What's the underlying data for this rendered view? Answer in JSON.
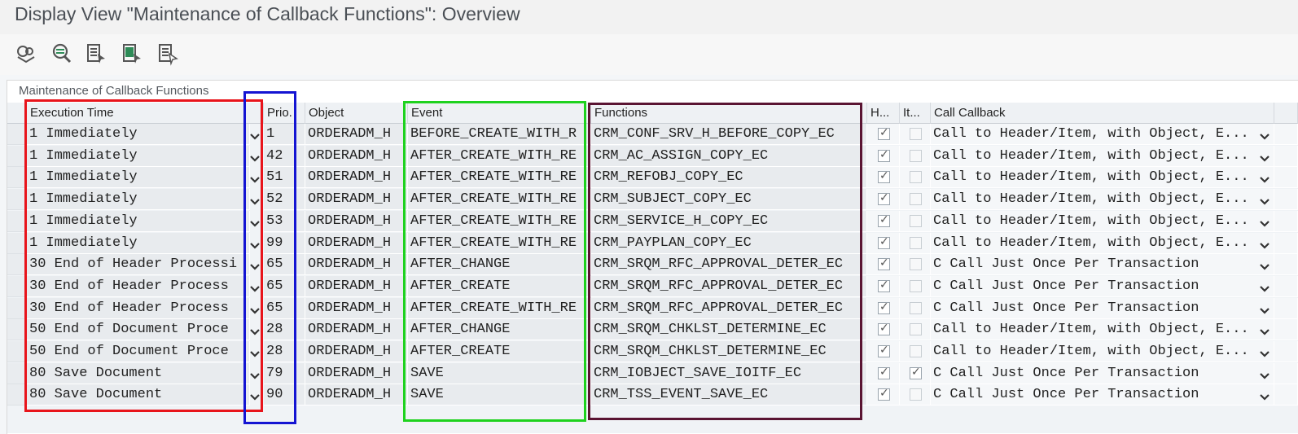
{
  "window": {
    "title": "Display View \"Maintenance of Callback Functions\": Overview"
  },
  "toolbar": {
    "buttons": [
      {
        "name": "display-change-icon"
      },
      {
        "name": "details-icon"
      },
      {
        "name": "select-all-icon"
      },
      {
        "name": "select-block-icon"
      },
      {
        "name": "deselect-all-icon"
      }
    ]
  },
  "panel": {
    "title": "Maintenance of Callback Functions"
  },
  "table": {
    "headers": {
      "execution_time": "Execution Time",
      "prio": "Prio.",
      "object": "Object",
      "event": "Event",
      "functions": "Functions",
      "h": "H...",
      "it": "It...",
      "call_callback": "Call Callback"
    },
    "rows": [
      {
        "exec": "1 Immediately",
        "prio": "1",
        "object": "ORDERADM_H",
        "event": "BEFORE_CREATE_WITH_R",
        "function": "CRM_CONF_SRV_H_BEFORE_COPY_EC",
        "h": true,
        "it": false,
        "callback": " Call to Header/Item, with Object, E..."
      },
      {
        "exec": "1 Immediately",
        "prio": "42",
        "object": "ORDERADM_H",
        "event": "AFTER_CREATE_WITH_RE",
        "function": "CRM_AC_ASSIGN_COPY_EC",
        "h": true,
        "it": false,
        "callback": " Call to Header/Item, with Object, E..."
      },
      {
        "exec": "1 Immediately",
        "prio": "51",
        "object": "ORDERADM_H",
        "event": "AFTER_CREATE_WITH_RE",
        "function": "CRM_REFOBJ_COPY_EC",
        "h": true,
        "it": false,
        "callback": " Call to Header/Item, with Object, E..."
      },
      {
        "exec": "1 Immediately",
        "prio": "52",
        "object": "ORDERADM_H",
        "event": "AFTER_CREATE_WITH_RE",
        "function": "CRM_SUBJECT_COPY_EC",
        "h": true,
        "it": false,
        "callback": " Call to Header/Item, with Object, E..."
      },
      {
        "exec": "1 Immediately",
        "prio": "53",
        "object": "ORDERADM_H",
        "event": "AFTER_CREATE_WITH_RE",
        "function": "CRM_SERVICE_H_COPY_EC",
        "h": true,
        "it": false,
        "callback": " Call to Header/Item, with Object, E..."
      },
      {
        "exec": "1 Immediately",
        "prio": "99",
        "object": "ORDERADM_H",
        "event": "AFTER_CREATE_WITH_RE",
        "function": "CRM_PAYPLAN_COPY_EC",
        "h": true,
        "it": false,
        "callback": " Call to Header/Item, with Object, E..."
      },
      {
        "exec": "30 End of Header Processi",
        "prio": "65",
        "object": "ORDERADM_H",
        "event": "AFTER_CHANGE",
        "function": "CRM_SRQM_RFC_APPROVAL_DETER_EC",
        "h": true,
        "it": false,
        "callback": "C Call Just Once Per Transaction"
      },
      {
        "exec": "30 End of Header Process",
        "prio": "65",
        "object": "ORDERADM_H",
        "event": "AFTER_CREATE",
        "function": "CRM_SRQM_RFC_APPROVAL_DETER_EC",
        "h": true,
        "it": false,
        "callback": "C Call Just Once Per Transaction"
      },
      {
        "exec": "30 End of Header Process",
        "prio": "65",
        "object": "ORDERADM_H",
        "event": "AFTER_CREATE_WITH_RE",
        "function": "CRM_SRQM_RFC_APPROVAL_DETER_EC",
        "h": true,
        "it": false,
        "callback": "C Call Just Once Per Transaction"
      },
      {
        "exec": "50 End of Document Proce",
        "prio": "28",
        "object": "ORDERADM_H",
        "event": "AFTER_CHANGE",
        "function": "CRM_SRQM_CHKLST_DETERMINE_EC",
        "h": true,
        "it": false,
        "callback": " Call to Header/Item, with Object, E..."
      },
      {
        "exec": "50 End of Document Proce",
        "prio": "28",
        "object": "ORDERADM_H",
        "event": "AFTER_CREATE",
        "function": "CRM_SRQM_CHKLST_DETERMINE_EC",
        "h": true,
        "it": false,
        "callback": " Call to Header/Item, with Object, E..."
      },
      {
        "exec": "80 Save Document",
        "prio": "79",
        "object": "ORDERADM_H",
        "event": "SAVE",
        "function": "CRM_IOBJECT_SAVE_IOITF_EC",
        "h": true,
        "it": true,
        "callback": "C Call Just Once Per Transaction"
      },
      {
        "exec": "80 Save Document",
        "prio": "90",
        "object": "ORDERADM_H",
        "event": "SAVE",
        "function": "CRM_TSS_EVENT_SAVE_EC",
        "h": true,
        "it": false,
        "callback": "C Call Just Once Per Transaction"
      }
    ]
  },
  "annotation_colors": {
    "execution_time": "#e8141b",
    "prio": "#1414d2",
    "event": "#1ed21e",
    "functions": "#5a1432"
  },
  "icons": {
    "dropdown": "chevron-down-icon"
  }
}
